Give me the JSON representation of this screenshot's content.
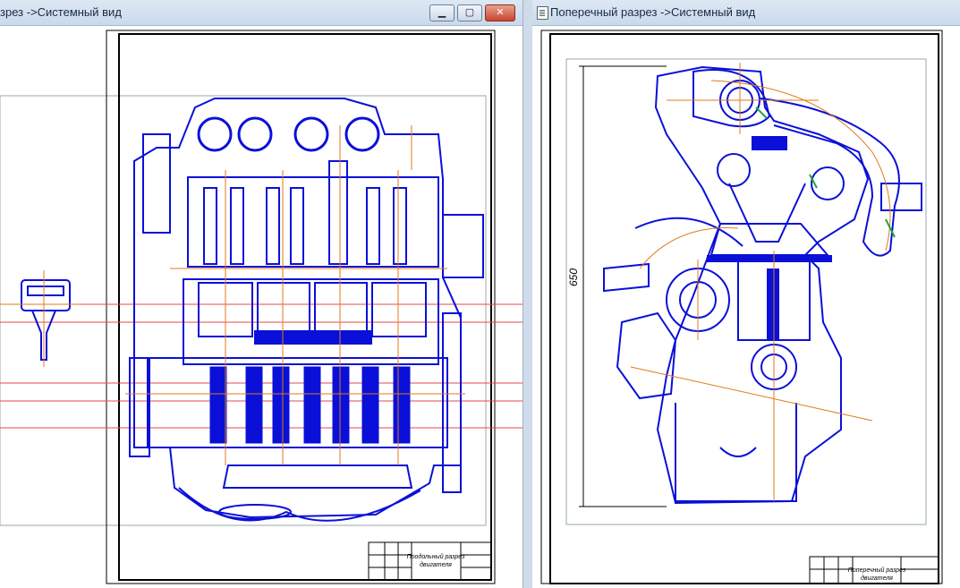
{
  "left_window": {
    "title": "зрез ->Системный вид",
    "minimize_label": "▁",
    "maximize_label": "▢",
    "close_label": "✕",
    "stamp_line1": "Продольный разрез",
    "stamp_line2": "двигателя"
  },
  "right_window": {
    "title": "Поперечный разрез ->Системный вид",
    "icon": "document-icon",
    "dimension_label": "650",
    "stamp_line1": "Поперечный разрез",
    "stamp_line2": "двигателя"
  },
  "colors": {
    "drawing_blue": "#0a10d8",
    "axis_orange": "#e07a1a",
    "frame_black": "#000000",
    "guide_red": "#e84a4a"
  }
}
